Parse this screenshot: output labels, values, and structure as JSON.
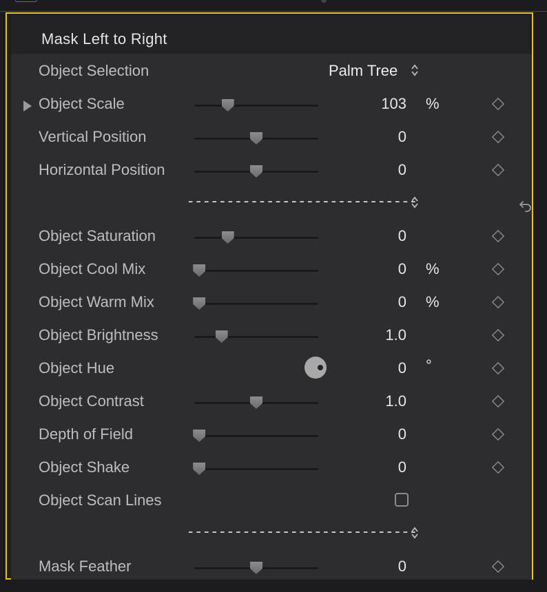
{
  "panel": {
    "title": "Mask Left to Right"
  },
  "rows": {
    "object_selection": {
      "label": "Object Selection",
      "value": "Palm Tree"
    },
    "object_scale": {
      "label": "Object Scale",
      "value": "103",
      "unit": "%",
      "slider_fraction": 0.27
    },
    "vertical_position": {
      "label": "Vertical Position",
      "value": "0",
      "slider_fraction": 0.5
    },
    "horizontal_position": {
      "label": "Horizontal Position",
      "value": "0",
      "slider_fraction": 0.5
    },
    "separator_1": {
      "value": "-----------------------------"
    },
    "object_saturation": {
      "label": "Object Saturation",
      "value": "0",
      "slider_fraction": 0.27
    },
    "object_cool_mix": {
      "label": "Object Cool Mix",
      "value": "0",
      "unit": "%",
      "slider_fraction": 0.04
    },
    "object_warm_mix": {
      "label": "Object Warm Mix",
      "value": "0",
      "unit": "%",
      "slider_fraction": 0.04
    },
    "object_brightness": {
      "label": "Object Brightness",
      "value": "1.0",
      "slider_fraction": 0.22
    },
    "object_hue": {
      "label": "Object Hue",
      "value": "0",
      "unit": "°"
    },
    "object_contrast": {
      "label": "Object Contrast",
      "value": "1.0",
      "slider_fraction": 0.5
    },
    "depth_of_field": {
      "label": "Depth of Field",
      "value": "0",
      "slider_fraction": 0.04
    },
    "object_shake": {
      "label": "Object Shake",
      "value": "0",
      "slider_fraction": 0.04
    },
    "object_scan_lines": {
      "label": "Object Scan Lines",
      "checked": false
    },
    "separator_2": {
      "value": "-----------------------------"
    },
    "mask_feather": {
      "label": "Mask Feather",
      "value": "0",
      "slider_fraction": 0.5
    }
  },
  "icons": {
    "keyframe": "diamond-icon",
    "reset": "undo-arrow-icon",
    "popup": "chevron-updown-icon",
    "disclosure": "triangle-right-icon"
  },
  "colors": {
    "highlight_border": "#e7c22a",
    "panel_bg": "#2d2d2f"
  }
}
